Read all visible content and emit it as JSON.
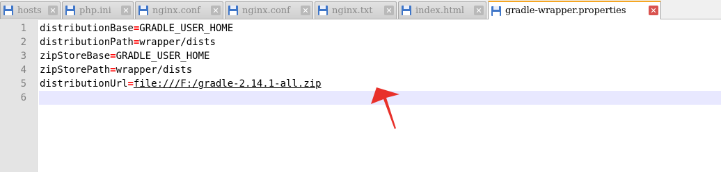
{
  "tabs": [
    {
      "label": "hosts",
      "active": false,
      "icon": "save-icon"
    },
    {
      "label": "php.ini",
      "active": false,
      "icon": "save-icon"
    },
    {
      "label": "nginx.conf",
      "active": false,
      "icon": "save-icon"
    },
    {
      "label": "nginx.conf",
      "active": false,
      "icon": "save-icon"
    },
    {
      "label": "nginx.txt",
      "active": false,
      "icon": "save-icon"
    },
    {
      "label": "index.html",
      "active": false,
      "icon": "save-icon"
    },
    {
      "label": "gradle-wrapper.properties",
      "active": true,
      "icon": "save-icon"
    }
  ],
  "close_glyph": "✕",
  "editor": {
    "lines": [
      {
        "number": "1",
        "key": "distributionBase",
        "eq": "=",
        "value": "GRADLE_USER_HOME"
      },
      {
        "number": "2",
        "key": "distributionPath",
        "eq": "=",
        "value": "wrapper/dists"
      },
      {
        "number": "3",
        "key": "zipStoreBase",
        "eq": "=",
        "value": "GRADLE_USER_HOME"
      },
      {
        "number": "4",
        "key": "zipStorePath",
        "eq": "=",
        "value": "wrapper/dists"
      },
      {
        "number": "5",
        "key": "distributionUrl",
        "eq": "=",
        "value": "file:///F:/gradle-2.14.1-all.zip"
      },
      {
        "number": "6",
        "key": "",
        "eq": "",
        "value": ""
      }
    ],
    "current_line": "6"
  },
  "colors": {
    "equals_sign": "#ff0000",
    "current_line_bg": "#e8e8ff",
    "gutter_bg": "#e4e4e4",
    "annotation_arrow": "#e8302a",
    "active_tab_accent": "#f5a623"
  }
}
